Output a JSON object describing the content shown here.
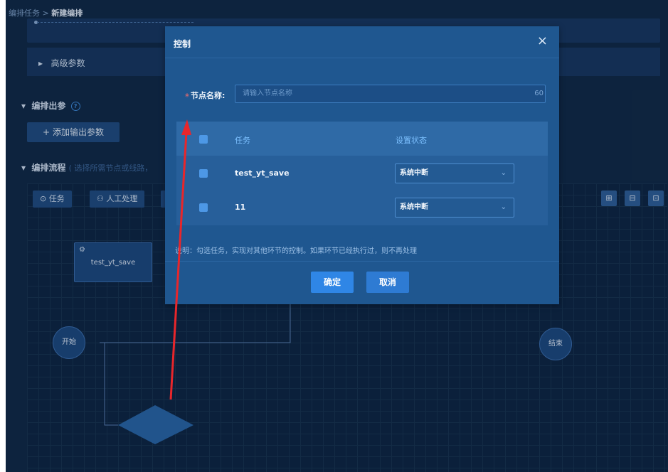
{
  "breadcrumb": {
    "parent": "编排任务",
    "separator": ">",
    "current": "新建编排"
  },
  "sections": {
    "advanced_params": "高级参数",
    "output_params": "编排出参",
    "add_output_param": "添加输出参数",
    "flow_title": "编排流程",
    "flow_hint": "( 选择所需节点或线路，"
  },
  "toolbar": {
    "task": "任务",
    "manual": "人工处理"
  },
  "canvas": {
    "task_node": "test_yt_save",
    "start_node": "开始",
    "end_node": "结束"
  },
  "modal": {
    "title": "控制",
    "close_glyph": "×",
    "required_mark": "*",
    "name_label": "节点名称:",
    "name_placeholder": "请输入节点名称",
    "name_max": "60",
    "table": {
      "headers": [
        "任务",
        "设置状态"
      ],
      "rows": [
        {
          "task": "test_yt_save",
          "status": "系统中断"
        },
        {
          "task": "11",
          "status": "系统中断"
        }
      ]
    },
    "note": "说明：勾选任务，实现对其他环节的控制。如果环节已经执行过，则不再处理",
    "confirm": "确定",
    "cancel": "取消"
  },
  "colors": {
    "page_bg": "#0f2846",
    "modal_bg": "#1f5790",
    "accent": "#2f86e6",
    "annotation_arrow": "#e8262b"
  }
}
